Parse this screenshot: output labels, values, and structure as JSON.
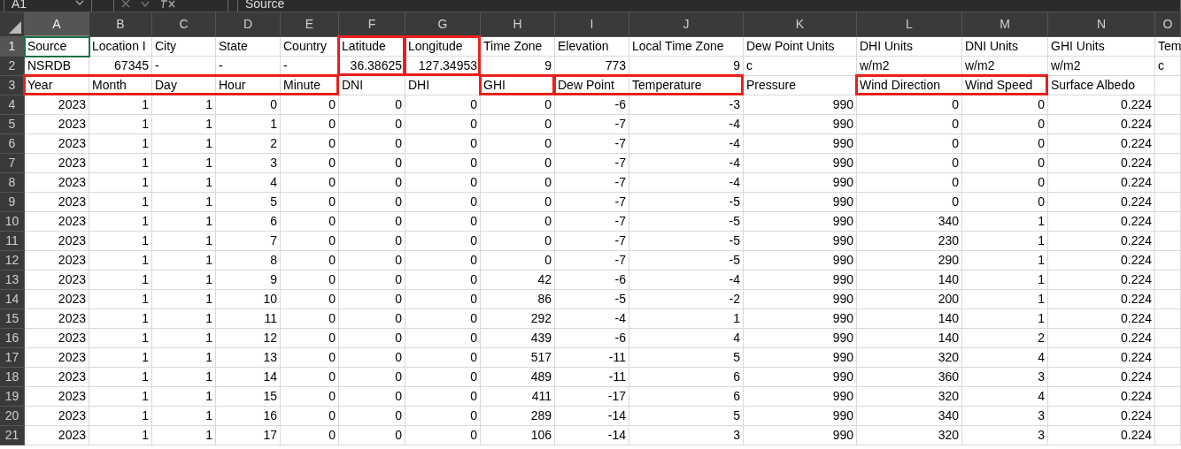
{
  "formula_bar": {
    "name_box": "A1",
    "formula": "Source"
  },
  "columns": [
    {
      "letter": "A",
      "selected": true
    },
    {
      "letter": "B",
      "selected": false
    },
    {
      "letter": "C",
      "selected": false
    },
    {
      "letter": "D",
      "selected": false
    },
    {
      "letter": "E",
      "selected": false
    },
    {
      "letter": "F",
      "selected": false
    },
    {
      "letter": "G",
      "selected": false
    },
    {
      "letter": "H",
      "selected": false
    },
    {
      "letter": "I",
      "selected": false
    },
    {
      "letter": "J",
      "selected": false
    },
    {
      "letter": "K",
      "selected": false
    },
    {
      "letter": "L",
      "selected": false
    },
    {
      "letter": "M",
      "selected": false
    },
    {
      "letter": "N",
      "selected": false
    },
    {
      "letter": "O",
      "selected": false
    }
  ],
  "rows": [
    {
      "number": "1",
      "selected": true,
      "kind": "text",
      "cells": [
        {
          "text": "Source",
          "framed": false
        },
        {
          "text": "Location I",
          "framed": false
        },
        {
          "text": "City",
          "framed": false
        },
        {
          "text": "State",
          "framed": false
        },
        {
          "text": "Country",
          "framed": false
        },
        {
          "text": "Latitude",
          "framed": true,
          "open_right": false,
          "open_down": true
        },
        {
          "text": "Longitude",
          "framed": true,
          "open_right": false,
          "open_down": true
        },
        {
          "text": "Time Zone",
          "framed": false
        },
        {
          "text": "Elevation",
          "framed": false
        },
        {
          "text": "Local Time Zone",
          "framed": false
        },
        {
          "text": "Dew Point Units",
          "framed": false
        },
        {
          "text": "DHI Units",
          "framed": false
        },
        {
          "text": "DNI Units",
          "framed": false
        },
        {
          "text": "GHI Units",
          "framed": false
        },
        {
          "text": "Tem",
          "framed": false
        }
      ]
    },
    {
      "number": "2",
      "selected": false,
      "kind": "mixed",
      "cells": [
        {
          "text": "NSRDB",
          "kind": "text",
          "framed": false
        },
        {
          "text": "67345",
          "kind": "number",
          "framed": false
        },
        {
          "text": "-",
          "kind": "text",
          "framed": false
        },
        {
          "text": "-",
          "kind": "text",
          "framed": false
        },
        {
          "text": "-",
          "kind": "text",
          "framed": false
        },
        {
          "text": "36.38625",
          "kind": "number",
          "framed": true,
          "open_right": false,
          "open_down": false
        },
        {
          "text": "127.34953",
          "kind": "number",
          "framed": true,
          "open_right": false,
          "open_down": false
        },
        {
          "text": "9",
          "kind": "number",
          "framed": false
        },
        {
          "text": "773",
          "kind": "number",
          "framed": false
        },
        {
          "text": "9",
          "kind": "number",
          "framed": false
        },
        {
          "text": "c",
          "kind": "text",
          "framed": false
        },
        {
          "text": "w/m2",
          "kind": "text",
          "framed": false
        },
        {
          "text": "w/m2",
          "kind": "text",
          "framed": false
        },
        {
          "text": "w/m2",
          "kind": "text",
          "framed": false
        },
        {
          "text": "c",
          "kind": "text",
          "framed": false
        }
      ]
    },
    {
      "number": "3",
      "selected": false,
      "kind": "text",
      "cells": [
        {
          "text": "Year",
          "framed": true,
          "open_right": true,
          "open_down": false
        },
        {
          "text": "Month",
          "framed": true,
          "open_right": true,
          "open_down": false
        },
        {
          "text": "Day",
          "framed": true,
          "open_right": true,
          "open_down": false
        },
        {
          "text": "Hour",
          "framed": true,
          "open_right": true,
          "open_down": false
        },
        {
          "text": "Minute",
          "framed": true,
          "open_right": false,
          "open_down": false
        },
        {
          "text": "DNI",
          "framed": false
        },
        {
          "text": "DHI",
          "framed": false
        },
        {
          "text": "GHI",
          "framed": true,
          "open_right": false,
          "open_down": false
        },
        {
          "text": "Dew Point",
          "framed": true,
          "open_right": true,
          "open_down": false
        },
        {
          "text": "Temperature",
          "framed": true,
          "open_right": false,
          "open_down": false
        },
        {
          "text": "Pressure",
          "framed": false
        },
        {
          "text": "Wind Direction",
          "framed": true,
          "open_right": true,
          "open_down": false
        },
        {
          "text": "Wind Speed",
          "framed": true,
          "open_right": false,
          "open_down": false
        },
        {
          "text": "Surface Albedo",
          "framed": false
        }
      ]
    },
    {
      "number": "4",
      "selected": false,
      "kind": "numeric",
      "cells": [
        "2023",
        "1",
        "1",
        "0",
        "0",
        "0",
        "0",
        "0",
        "-6",
        "-3",
        "990",
        "0",
        "0",
        "0.224"
      ]
    },
    {
      "number": "5",
      "selected": false,
      "kind": "numeric",
      "cells": [
        "2023",
        "1",
        "1",
        "1",
        "0",
        "0",
        "0",
        "0",
        "-7",
        "-4",
        "990",
        "0",
        "0",
        "0.224"
      ]
    },
    {
      "number": "6",
      "selected": false,
      "kind": "numeric",
      "cells": [
        "2023",
        "1",
        "1",
        "2",
        "0",
        "0",
        "0",
        "0",
        "-7",
        "-4",
        "990",
        "0",
        "0",
        "0.224"
      ]
    },
    {
      "number": "7",
      "selected": false,
      "kind": "numeric",
      "cells": [
        "2023",
        "1",
        "1",
        "3",
        "0",
        "0",
        "0",
        "0",
        "-7",
        "-4",
        "990",
        "0",
        "0",
        "0.224"
      ]
    },
    {
      "number": "8",
      "selected": false,
      "kind": "numeric",
      "cells": [
        "2023",
        "1",
        "1",
        "4",
        "0",
        "0",
        "0",
        "0",
        "-7",
        "-4",
        "990",
        "0",
        "0",
        "0.224"
      ]
    },
    {
      "number": "9",
      "selected": false,
      "kind": "numeric",
      "cells": [
        "2023",
        "1",
        "1",
        "5",
        "0",
        "0",
        "0",
        "0",
        "-7",
        "-5",
        "990",
        "0",
        "0",
        "0.224"
      ]
    },
    {
      "number": "10",
      "selected": false,
      "kind": "numeric",
      "cells": [
        "2023",
        "1",
        "1",
        "6",
        "0",
        "0",
        "0",
        "0",
        "-7",
        "-5",
        "990",
        "340",
        "1",
        "0.224"
      ]
    },
    {
      "number": "11",
      "selected": false,
      "kind": "numeric",
      "cells": [
        "2023",
        "1",
        "1",
        "7",
        "0",
        "0",
        "0",
        "0",
        "-7",
        "-5",
        "990",
        "230",
        "1",
        "0.224"
      ]
    },
    {
      "number": "12",
      "selected": false,
      "kind": "numeric",
      "cells": [
        "2023",
        "1",
        "1",
        "8",
        "0",
        "0",
        "0",
        "0",
        "-7",
        "-5",
        "990",
        "290",
        "1",
        "0.224"
      ]
    },
    {
      "number": "13",
      "selected": false,
      "kind": "numeric",
      "cells": [
        "2023",
        "1",
        "1",
        "9",
        "0",
        "0",
        "0",
        "42",
        "-6",
        "-4",
        "990",
        "140",
        "1",
        "0.224"
      ]
    },
    {
      "number": "14",
      "selected": false,
      "kind": "numeric",
      "cells": [
        "2023",
        "1",
        "1",
        "10",
        "0",
        "0",
        "0",
        "86",
        "-5",
        "-2",
        "990",
        "200",
        "1",
        "0.224"
      ]
    },
    {
      "number": "15",
      "selected": false,
      "kind": "numeric",
      "cells": [
        "2023",
        "1",
        "1",
        "11",
        "0",
        "0",
        "0",
        "292",
        "-4",
        "1",
        "990",
        "140",
        "1",
        "0.224"
      ]
    },
    {
      "number": "16",
      "selected": false,
      "kind": "numeric",
      "cells": [
        "2023",
        "1",
        "1",
        "12",
        "0",
        "0",
        "0",
        "439",
        "-6",
        "4",
        "990",
        "140",
        "2",
        "0.224"
      ]
    },
    {
      "number": "17",
      "selected": false,
      "kind": "numeric",
      "cells": [
        "2023",
        "1",
        "1",
        "13",
        "0",
        "0",
        "0",
        "517",
        "-11",
        "5",
        "990",
        "320",
        "4",
        "0.224"
      ]
    },
    {
      "number": "18",
      "selected": false,
      "kind": "numeric",
      "cells": [
        "2023",
        "1",
        "1",
        "14",
        "0",
        "0",
        "0",
        "489",
        "-11",
        "6",
        "990",
        "360",
        "3",
        "0.224"
      ]
    },
    {
      "number": "19",
      "selected": false,
      "kind": "numeric",
      "cells": [
        "2023",
        "1",
        "1",
        "15",
        "0",
        "0",
        "0",
        "411",
        "-17",
        "6",
        "990",
        "320",
        "4",
        "0.224"
      ]
    },
    {
      "number": "20",
      "selected": false,
      "kind": "numeric",
      "cells": [
        "2023",
        "1",
        "1",
        "16",
        "0",
        "0",
        "0",
        "289",
        "-14",
        "5",
        "990",
        "340",
        "3",
        "0.224"
      ]
    },
    {
      "number": "21",
      "selected": false,
      "kind": "numeric",
      "cells": [
        "2023",
        "1",
        "1",
        "17",
        "0",
        "0",
        "0",
        "106",
        "-14",
        "3",
        "990",
        "320",
        "3",
        "0.224"
      ]
    }
  ]
}
